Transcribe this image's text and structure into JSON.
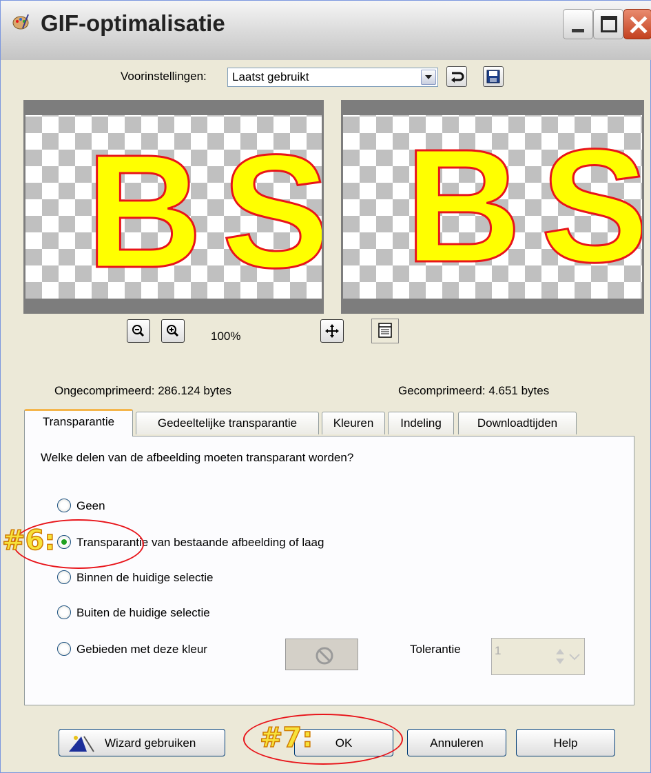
{
  "window": {
    "title": "GIF-optimalisatie"
  },
  "presets": {
    "label": "Voorinstellingen:",
    "value": "Laatst gebruikt"
  },
  "preview": {
    "letters": "BS",
    "zoom": "100%"
  },
  "stats": {
    "uncompressed": "Ongecomprimeerd:  286.124 bytes",
    "compressed": "Gecomprimeerd: 4.651 bytes"
  },
  "tabs": [
    {
      "label": "Transparantie"
    },
    {
      "label": "Gedeeltelijke transparantie"
    },
    {
      "label": "Kleuren"
    },
    {
      "label": "Indeling"
    },
    {
      "label": "Downloadtijden"
    }
  ],
  "panel": {
    "question": "Welke delen van de afbeelding moeten transparant worden?",
    "options": [
      {
        "label": "Geen",
        "checked": false
      },
      {
        "label": "Transparantie van bestaande afbeelding of laag",
        "checked": true
      },
      {
        "label": "Binnen de huidige selectie",
        "checked": false
      },
      {
        "label": "Buiten de huidige selectie",
        "checked": false
      },
      {
        "label": "Gebieden met deze kleur",
        "checked": false
      }
    ],
    "tolerance_label": "Tolerantie",
    "tolerance_value": "1"
  },
  "buttons": {
    "wizard": "Wizard gebruiken",
    "ok": "OK",
    "cancel": "Annuleren",
    "help": "Help"
  },
  "annotations": {
    "step6": "#6:",
    "step7": "#7:"
  },
  "colors": {
    "letter_fill": "#ffff00",
    "letter_outline": "#e8141a",
    "annotation_red": "#e8141a",
    "annotation_yellow": "#f7e23a"
  }
}
